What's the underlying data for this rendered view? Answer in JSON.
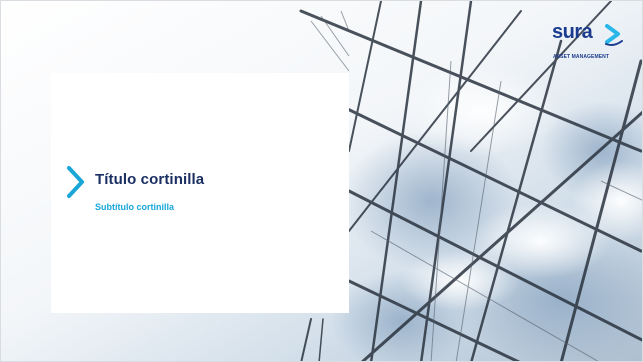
{
  "slide": {
    "title": "Título cortinilla",
    "subtitle": "Subtítulo cortinilla"
  },
  "logo": {
    "brand": "sura",
    "tagline": "ASSET MANAGEMENT"
  },
  "icons": {
    "chevron": "chevron-right-icon",
    "logo_mark": "sura-arrow-mark"
  },
  "colors": {
    "title": "#1b2f63",
    "subtitle": "#1aa7d8",
    "chevron": "#1aa7d8",
    "brand_blue": "#1b3b8f",
    "brand_cyan": "#29b6e8",
    "card": "#ffffff"
  }
}
